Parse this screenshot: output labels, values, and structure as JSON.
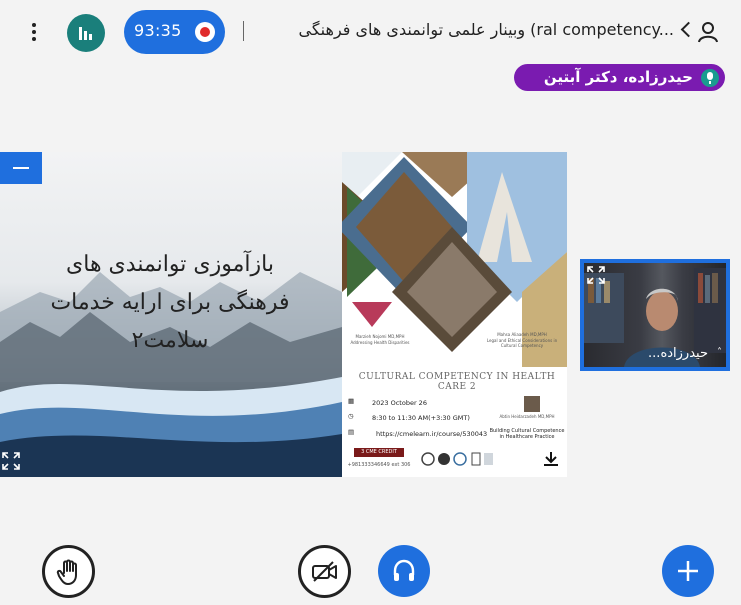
{
  "header": {
    "timer": "93:35",
    "title": "وبینار علمی توانمندی های فرهنگی (ral competency..."
  },
  "speaker": {
    "name": "حیدرزاده، دکتر آبتین"
  },
  "slide": {
    "title_lines": [
      "بازآموزی توانمندی های",
      "فرهنگی برای ارایه خدمات",
      "سلامت۲"
    ],
    "poster": {
      "heading": "CULTURAL COMPETENCY IN HEALTH CARE 2",
      "date": "2023 October 26",
      "time": "8:30 to 11:30 AM(+3:30 GMT)",
      "url": "https://cmelearn.ir/course/530043",
      "credit": "3 CME CREDIT",
      "phone": "+981333346649 ext 306",
      "speaker1_name": "Marzieh Nojomi MD,MPH",
      "speaker1_topic": "Addressing Health Disparities",
      "speaker2_name": "Mahsa Aliaadeh MD,MPH",
      "speaker2_topic": "Legal and Ethical Considerations in Cultural Competency",
      "speaker3_name": "Abtin Heidarzadeh MD,MPH",
      "speaker3_topic": "Building Cultural Competence in Healthcare Practice"
    }
  },
  "webcam": {
    "name": "حیدرزاده..."
  },
  "colors": {
    "accent": "#1f6fde",
    "speaker_pill": "#7a1bb0",
    "stats": "#1a7f7b",
    "record": "#e02a2a"
  }
}
